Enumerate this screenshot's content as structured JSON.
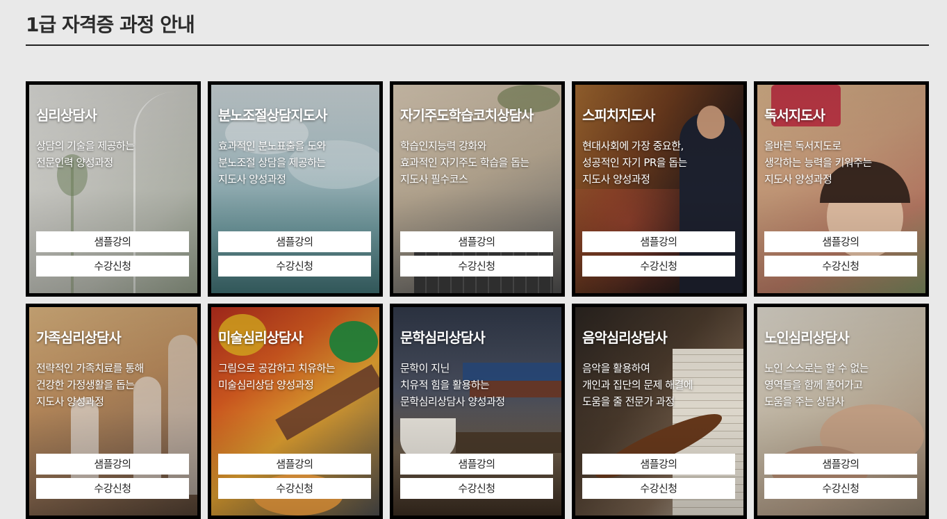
{
  "page": {
    "title": "1급 자격증 과정 안내"
  },
  "buttons": {
    "sample_label": "샘플강의",
    "enroll_label": "수강신청"
  },
  "cards": [
    {
      "title": "심리상담사",
      "desc": [
        "상담의 기술을 제공하는",
        "전문인력 양성과정"
      ]
    },
    {
      "title": "분노조절상담지도사",
      "desc": [
        "효과적인 분노표출을 도와",
        "분노조절 상담을 제공하는",
        "지도사 양성과정"
      ]
    },
    {
      "title": "자기주도학습코치상담사",
      "desc": [
        "학습인지능력 강화와",
        "효과적인 자기주도 학습을 돕는",
        "지도사 필수코스"
      ]
    },
    {
      "title": "스피치지도사",
      "desc": [
        "현대사회에 가장 중요한,",
        "성공적인 자기 PR을 돕는",
        "지도사 양성과정"
      ]
    },
    {
      "title": "독서지도사",
      "desc": [
        "올바른 독서지도로",
        "생각하는 능력을 키워주는",
        "지도사 양성과정"
      ]
    },
    {
      "title": "가족심리상담사",
      "desc": [
        "전략적인 가족치료를 통해",
        "건강한 가정생활을 돕는",
        "지도사 양성과정"
      ]
    },
    {
      "title": "미술심리상담사",
      "desc": [
        "그림으로 공감하고 치유하는",
        "미술심리상담 양성과정"
      ]
    },
    {
      "title": "문학심리상담사",
      "desc": [
        "문학이 지닌",
        "치유적 힘을 활용하는",
        "문학심리상담사 양성과정"
      ]
    },
    {
      "title": "음악심리상담사",
      "desc": [
        "음악을 활용하여",
        "개인과 집단의 문제 해결에",
        "도움을 줄 전문가 과정"
      ]
    },
    {
      "title": "노인심리상담사",
      "desc": [
        "노인 스스로는 할 수 없는",
        "영역들을 함께 풀어가고",
        "도움을 주는 상담사"
      ]
    }
  ]
}
